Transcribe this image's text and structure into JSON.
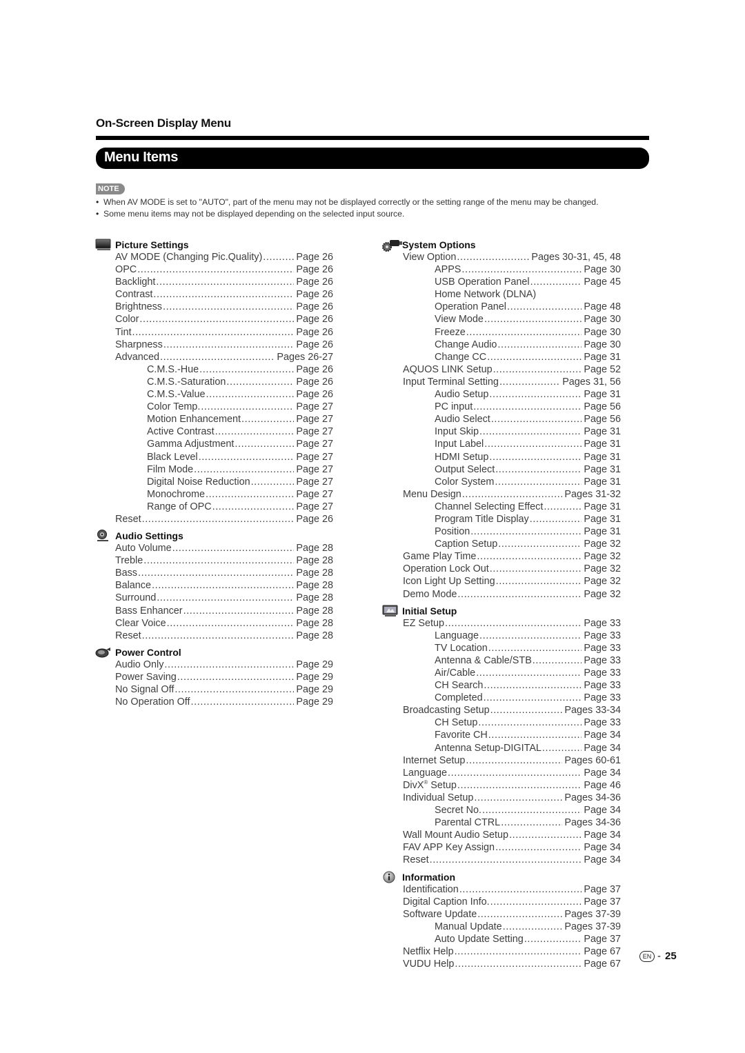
{
  "header": {
    "section_title": "On-Screen Display Menu",
    "banner_title": "Menu Items"
  },
  "note": {
    "badge": "NOTE",
    "items": [
      "When AV MODE is set to \"AUTO\", part of the menu may not be displayed correctly or the setting range of the menu may be changed.",
      "Some menu items may not be displayed depending on the selected input source."
    ]
  },
  "left_column": {
    "picture_settings": {
      "title": "Picture Settings",
      "icon": "tv-monitor-icon",
      "items": [
        {
          "label": "AV MODE (Changing Pic.Quality)",
          "page": "Page 26",
          "level": 1
        },
        {
          "label": "OPC",
          "page": "Page 26",
          "level": 1
        },
        {
          "label": "Backlight",
          "page": "Page 26",
          "level": 1
        },
        {
          "label": "Contrast",
          "page": "Page 26",
          "level": 1
        },
        {
          "label": "Brightness",
          "page": "Page 26",
          "level": 1
        },
        {
          "label": "Color",
          "page": "Page 26",
          "level": 1
        },
        {
          "label": "Tint",
          "page": "Page 26",
          "level": 1
        },
        {
          "label": "Sharpness",
          "page": "Page 26",
          "level": 1
        },
        {
          "label": "Advanced",
          "page": "Pages 26-27",
          "level": 1
        },
        {
          "label": "C.M.S.-Hue",
          "page": "Page 26",
          "level": 2
        },
        {
          "label": "C.M.S.-Saturation",
          "page": "Page 26",
          "level": 2
        },
        {
          "label": "C.M.S.-Value",
          "page": "Page 26",
          "level": 2
        },
        {
          "label": "Color Temp.",
          "page": "Page 27",
          "level": 2
        },
        {
          "label": "Motion Enhancement",
          "page": "Page 27",
          "level": 2
        },
        {
          "label": "Active Contrast",
          "page": "Page 27",
          "level": 2
        },
        {
          "label": "Gamma Adjustment",
          "page": "Page 27",
          "level": 2
        },
        {
          "label": "Black Level",
          "page": "Page 27",
          "level": 2
        },
        {
          "label": "Film Mode",
          "page": "Page 27",
          "level": 2
        },
        {
          "label": "Digital Noise Reduction",
          "page": "Page 27",
          "level": 2
        },
        {
          "label": "Monochrome",
          "page": "Page 27",
          "level": 2
        },
        {
          "label": "Range of OPC",
          "page": "Page 27",
          "level": 2
        },
        {
          "label": "Reset",
          "page": "Page 26",
          "level": 1
        }
      ]
    },
    "audio_settings": {
      "title": "Audio Settings",
      "icon": "speaker-icon",
      "items": [
        {
          "label": "Auto Volume",
          "page": "Page 28",
          "level": 1
        },
        {
          "label": "Treble",
          "page": "Page 28",
          "level": 1
        },
        {
          "label": "Bass",
          "page": "Page 28",
          "level": 1
        },
        {
          "label": "Balance",
          "page": "Page 28",
          "level": 1
        },
        {
          "label": "Surround",
          "page": "Page 28",
          "level": 1
        },
        {
          "label": "Bass Enhancer",
          "page": "Page 28",
          "level": 1
        },
        {
          "label": "Clear Voice",
          "page": "Page 28",
          "level": 1
        },
        {
          "label": "Reset",
          "page": "Page 28",
          "level": 1
        }
      ]
    },
    "power_control": {
      "title": "Power Control",
      "icon": "power-plug-icon",
      "items": [
        {
          "label": "Audio Only",
          "page": "Page 29",
          "level": 1
        },
        {
          "label": "Power Saving",
          "page": "Page 29",
          "level": 1
        },
        {
          "label": "No Signal Off",
          "page": "Page 29",
          "level": 1
        },
        {
          "label": "No Operation Off",
          "page": "Page 29",
          "level": 1
        }
      ]
    }
  },
  "right_column": {
    "system_options": {
      "title": "System Options",
      "icon": "gear-plug-icon",
      "items": [
        {
          "label": "View Option",
          "page": "Pages 30-31, 45, 48",
          "level": 1
        },
        {
          "label": "APPS",
          "page": "Page 30",
          "level": 2
        },
        {
          "label": "USB Operation Panel",
          "page": "Page 45",
          "level": 2
        },
        {
          "label": "Home Network (DLNA)",
          "page": "",
          "level": 2
        },
        {
          "label": "Operation Panel",
          "page": "Page 48",
          "level": 2
        },
        {
          "label": "View Mode",
          "page": "Page 30",
          "level": 2
        },
        {
          "label": "Freeze",
          "page": "Page 30",
          "level": 2
        },
        {
          "label": "Change Audio",
          "page": "Page 30",
          "level": 2
        },
        {
          "label": "Change CC",
          "page": "Page 31",
          "level": 2
        },
        {
          "label": "AQUOS LINK Setup",
          "page": "Page 52",
          "level": 1
        },
        {
          "label": "Input Terminal Setting",
          "page": "Pages 31, 56",
          "level": 1
        },
        {
          "label": "Audio Setup",
          "page": "Page 31",
          "level": 2
        },
        {
          "label": "PC input",
          "page": "Page 56",
          "level": 2
        },
        {
          "label": "Audio Select",
          "page": "Page 56",
          "level": 2
        },
        {
          "label": "Input Skip",
          "page": "Page 31",
          "level": 2
        },
        {
          "label": "Input Label",
          "page": "Page 31",
          "level": 2
        },
        {
          "label": "HDMI Setup",
          "page": "Page 31",
          "level": 2
        },
        {
          "label": "Output Select",
          "page": "Page 31",
          "level": 2
        },
        {
          "label": "Color System",
          "page": "Page 31",
          "level": 2
        },
        {
          "label": "Menu Design",
          "page": "Pages 31-32",
          "level": 1
        },
        {
          "label": "Channel Selecting Effect",
          "page": "Page 31",
          "level": 2
        },
        {
          "label": "Program Title Display",
          "page": "Page 31",
          "level": 2
        },
        {
          "label": "Position",
          "page": "Page 31",
          "level": 2
        },
        {
          "label": "Caption Setup",
          "page": "Page 32",
          "level": 2
        },
        {
          "label": "Game Play Time",
          "page": "Page 32",
          "level": 1
        },
        {
          "label": "Operation Lock Out",
          "page": "Page 32",
          "level": 1
        },
        {
          "label": "Icon Light Up Setting",
          "page": "Page 32",
          "level": 1
        },
        {
          "label": "Demo Mode",
          "page": "Page 32",
          "level": 1
        }
      ]
    },
    "initial_setup": {
      "title": "Initial Setup",
      "icon": "setup-monitor-icon",
      "items": [
        {
          "label": "EZ Setup",
          "page": "Page 33",
          "level": 1
        },
        {
          "label": "Language",
          "page": "Page 33",
          "level": 2
        },
        {
          "label": "TV Location",
          "page": "Page 33",
          "level": 2
        },
        {
          "label": "Antenna & Cable/STB",
          "page": "Page 33",
          "level": 2
        },
        {
          "label": "Air/Cable",
          "page": "Page 33",
          "level": 2
        },
        {
          "label": "CH Search",
          "page": "Page 33",
          "level": 2
        },
        {
          "label": "Completed",
          "page": "Page 33",
          "level": 2
        },
        {
          "label": "Broadcasting Setup",
          "page": "Pages 33-34",
          "level": 1
        },
        {
          "label": "CH Setup",
          "page": "Page 33",
          "level": 2
        },
        {
          "label": "Favorite CH",
          "page": "Page 34",
          "level": 2
        },
        {
          "label": "Antenna Setup-DIGITAL",
          "page": "Page 34",
          "level": 2
        },
        {
          "label": "Internet Setup",
          "page": "Pages 60-61",
          "level": 1
        },
        {
          "label": "Language",
          "page": "Page 34",
          "level": 1
        },
        {
          "label": "DivX® Setup",
          "page": "Page 46",
          "level": 1
        },
        {
          "label": "Individual Setup",
          "page": "Pages 34-36",
          "level": 1
        },
        {
          "label": "Secret No.",
          "page": "Page 34",
          "level": 2
        },
        {
          "label": "Parental CTRL",
          "page": "Pages 34-36",
          "level": 2
        },
        {
          "label": "Wall Mount Audio Setup",
          "page": "Page 34",
          "level": 1
        },
        {
          "label": "FAV APP Key Assign",
          "page": "Page 34",
          "level": 1
        },
        {
          "label": "Reset",
          "page": "Page 34",
          "level": 1
        }
      ]
    },
    "information": {
      "title": "Information",
      "icon": "info-icon",
      "items": [
        {
          "label": "Identification",
          "page": "Page 37",
          "level": 1
        },
        {
          "label": "Digital Caption Info.",
          "page": "Page 37",
          "level": 1
        },
        {
          "label": "Software Update",
          "page": "Pages 37-39",
          "level": 1
        },
        {
          "label": "Manual Update",
          "page": "Pages 37-39",
          "level": 2
        },
        {
          "label": "Auto Update Setting",
          "page": "Page 37",
          "level": 2
        },
        {
          "label": "Netflix Help",
          "page": "Page 67",
          "level": 1
        },
        {
          "label": "VUDU Help",
          "page": "Page 67",
          "level": 1
        }
      ]
    }
  },
  "footer": {
    "lang_mark": "EN",
    "separator": "-",
    "page_number": "25"
  }
}
